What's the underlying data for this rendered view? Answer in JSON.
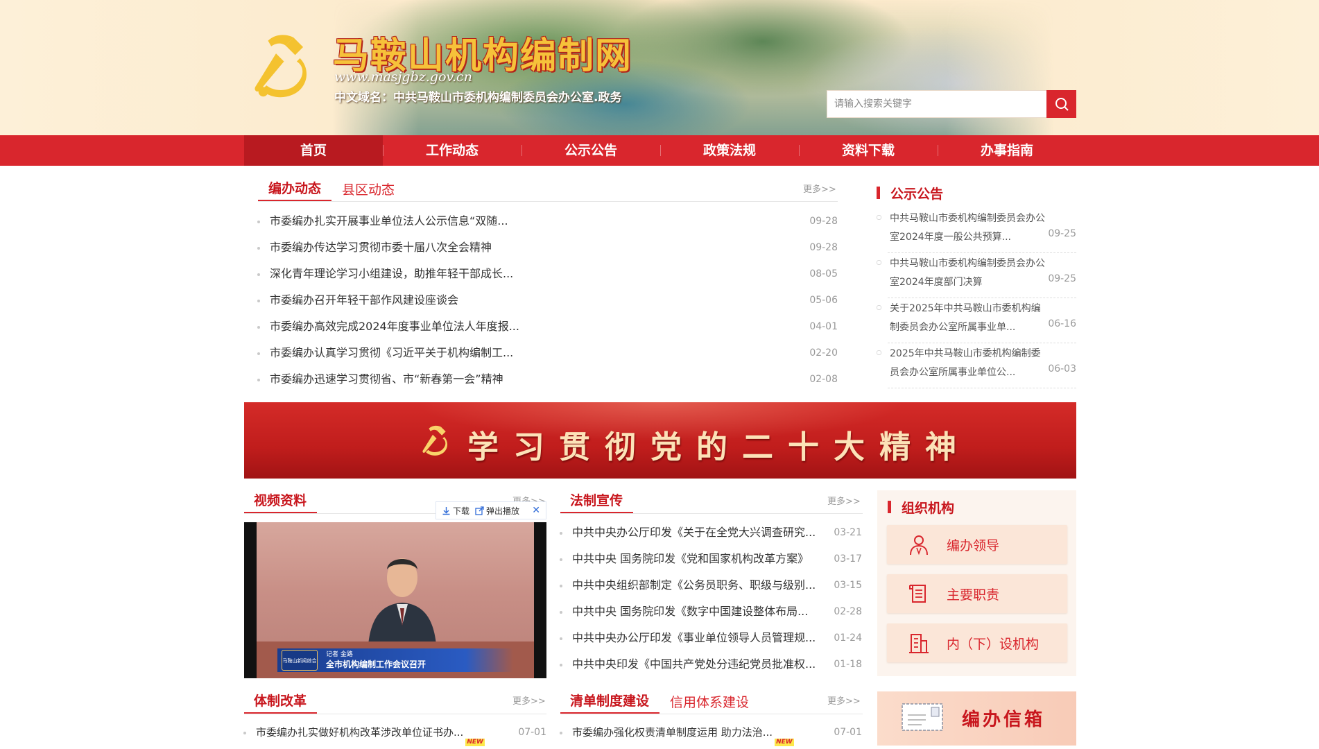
{
  "header": {
    "site_title": "马鞍山机构编制网",
    "site_url": "www.masjgbz.gov.cn",
    "cn_domain": "中文域名：中共马鞍山市委机构编制委员会办公室.政务",
    "search_placeholder": "请输入搜索关键字"
  },
  "nav": {
    "items": [
      "首页",
      "工作动态",
      "公示公告",
      "政策法规",
      "资料下载",
      "办事指南"
    ]
  },
  "news": {
    "tabs": [
      "编办动态",
      "县区动态"
    ],
    "more": "更多>>",
    "items": [
      {
        "title": "市委编办扎实开展事业单位法人公示信息“双随...",
        "date": "09-28"
      },
      {
        "title": "市委编办传达学习贯彻市委十届八次全会精神",
        "date": "09-28"
      },
      {
        "title": "深化青年理论学习小组建设，助推年轻干部成长...",
        "date": "08-05"
      },
      {
        "title": "市委编办召开年轻干部作风建设座谈会",
        "date": "05-06"
      },
      {
        "title": "市委编办高效完成2024年度事业单位法人年度报...",
        "date": "04-01"
      },
      {
        "title": "市委编办认真学习贯彻《习近平关于机构编制工...",
        "date": "02-20"
      },
      {
        "title": "市委编办迅速学习贯彻省、市“新春第一会”精神",
        "date": "02-08"
      }
    ]
  },
  "notices": {
    "title": "公示公告",
    "items": [
      {
        "title": "中共马鞍山市委机构编制委员会办公室2024年度一般公共预算...",
        "date": "09-25"
      },
      {
        "title": "中共马鞍山市委机构编制委员会办公室2024年度部门决算",
        "date": "09-25"
      },
      {
        "title": "关于2025年中共马鞍山市委机构编制委员会办公室所属事业单...",
        "date": "06-16"
      },
      {
        "title": "2025年中共马鞍山市委机构编制委员会办公室所属事业单位公...",
        "date": "06-03"
      }
    ]
  },
  "banner": {
    "text": "学习贯彻党的二十大精神"
  },
  "video": {
    "title": "视频资料",
    "more": "更多>>",
    "toolbar_download": "下载",
    "toolbar_popout": "弹出播放",
    "caption_small": "记者 金路",
    "caption": "全市机构编制工作会议召开",
    "channel_logo": "马鞍山新闻综合"
  },
  "law": {
    "title": "法制宣传",
    "more": "更多>>",
    "items": [
      {
        "title": "中共中央办公厅印发《关于在全党大兴调查研究...",
        "date": "03-21"
      },
      {
        "title": "中共中央 国务院印发《党和国家机构改革方案》",
        "date": "03-17"
      },
      {
        "title": "中共中央组织部制定《公务员职务、职级与级别...",
        "date": "03-15"
      },
      {
        "title": "中共中央 国务院印发《数字中国建设整体布局...",
        "date": "02-28"
      },
      {
        "title": "中共中央办公厅印发《事业单位领导人员管理规...",
        "date": "01-24"
      },
      {
        "title": "中共中央印发《中国共产党处分违纪党员批准权...",
        "date": "01-18"
      }
    ]
  },
  "org": {
    "title": "组织机构",
    "buttons": [
      {
        "label": "编办领导",
        "icon": "person-icon"
      },
      {
        "label": "主要职责",
        "icon": "scroll-icon"
      },
      {
        "label": "内（下）设机构",
        "icon": "building-icon"
      }
    ]
  },
  "reform": {
    "title": "体制改革",
    "more": "更多>>",
    "items": [
      {
        "title": "市委编办扎实做好机构改革涉改单位证书办...",
        "date": "07-01",
        "badge": "NEW"
      }
    ]
  },
  "lists": {
    "tabs": [
      "清单制度建设",
      "信用体系建设"
    ],
    "more": "更多>>",
    "items": [
      {
        "title": "市委编办强化权责清单制度运用 助力法治...",
        "date": "07-01",
        "badge": "NEW"
      }
    ]
  },
  "mailbox": {
    "label": "编办信箱"
  },
  "colors": {
    "brand_red": "#d9262d",
    "nav_active": "#b81a20",
    "gold": "#f6c23a"
  }
}
